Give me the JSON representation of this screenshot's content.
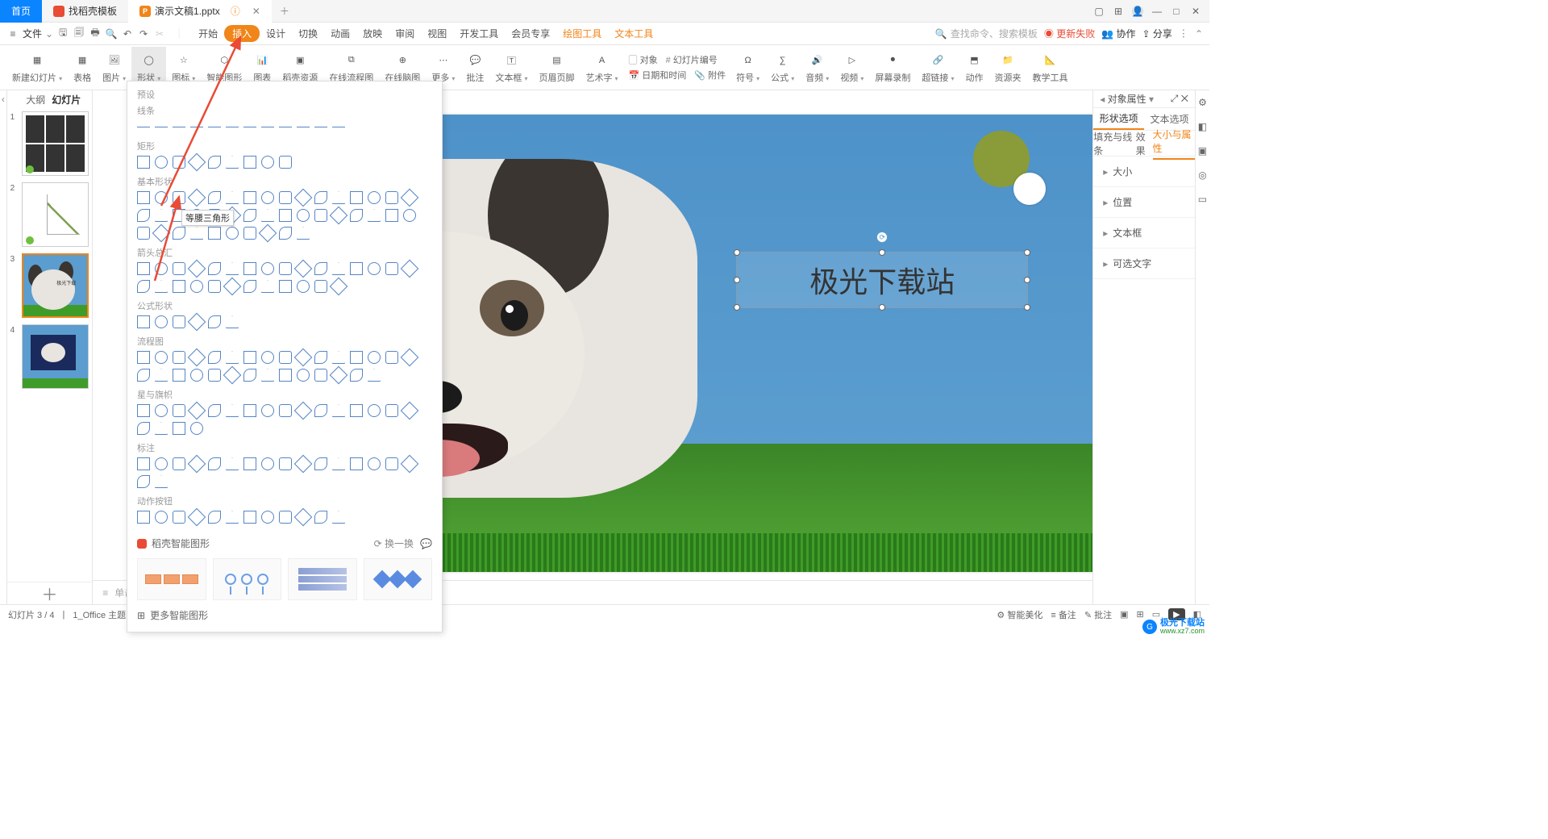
{
  "titlebar": {
    "home": "首页",
    "tab1": "找稻壳模板",
    "tab2": "演示文稿1.pptx"
  },
  "menu": {
    "file": "文件",
    "items": [
      "开始",
      "插入",
      "设计",
      "切换",
      "动画",
      "放映",
      "审阅",
      "视图",
      "开发工具",
      "会员专享",
      "绘图工具",
      "文本工具"
    ],
    "active_index": 1,
    "toolset_indexes": [
      10,
      11
    ],
    "search_placeholder": "查找命令、搜索模板",
    "update_fail": "更新失败",
    "collab": "协作",
    "share": "分享"
  },
  "ribbon": [
    "新建幻灯片",
    "表格",
    "图片",
    "形状",
    "图标",
    "智能图形",
    "图表",
    "稻壳资源",
    "在线流程图",
    "在线脑图",
    "更多",
    "批注",
    "文本框",
    "页眉页脚",
    "艺术字",
    "对象",
    "幻灯片编号",
    "日期和时间",
    "附件",
    "符号",
    "公式",
    "音频",
    "视频",
    "屏幕录制",
    "超链接",
    "动作",
    "资源夹",
    "教学工具"
  ],
  "ribbon_active_index": 3,
  "ribbon_inline_pairs": {
    "15": "对象",
    "16": "幻灯片编号",
    "17": "日期和时间",
    "18": "附件"
  },
  "thumb": {
    "outline": "大纲",
    "slides": "幻灯片",
    "count": 4,
    "selected": 3
  },
  "slide": {
    "text": "极光下载站"
  },
  "shapes": {
    "presets": "预设",
    "sections": [
      "线条",
      "矩形",
      "基本形状",
      "箭头总汇",
      "公式形状",
      "流程图",
      "星与旗帜",
      "标注",
      "动作按钮"
    ],
    "tooltip": "等腰三角形",
    "smart": "稻壳智能图形",
    "swap": "换一换",
    "more": "更多智能图形"
  },
  "properties": {
    "title": "对象属性",
    "tab1": "形状选项",
    "tab2": "文本选项",
    "sub": [
      "填充与线条",
      "效果",
      "大小与属性"
    ],
    "sections": [
      "大小",
      "位置",
      "文本框",
      "可选文字"
    ]
  },
  "notes": "单击此处添加备注",
  "status": {
    "slide": "幻灯片 3 / 4",
    "theme": "1_Office 主题",
    "beautify": "智能美化",
    "notes": "备注",
    "annot": "批注"
  },
  "watermark": {
    "name": "极光下载站",
    "url": "www.xz7.com"
  }
}
